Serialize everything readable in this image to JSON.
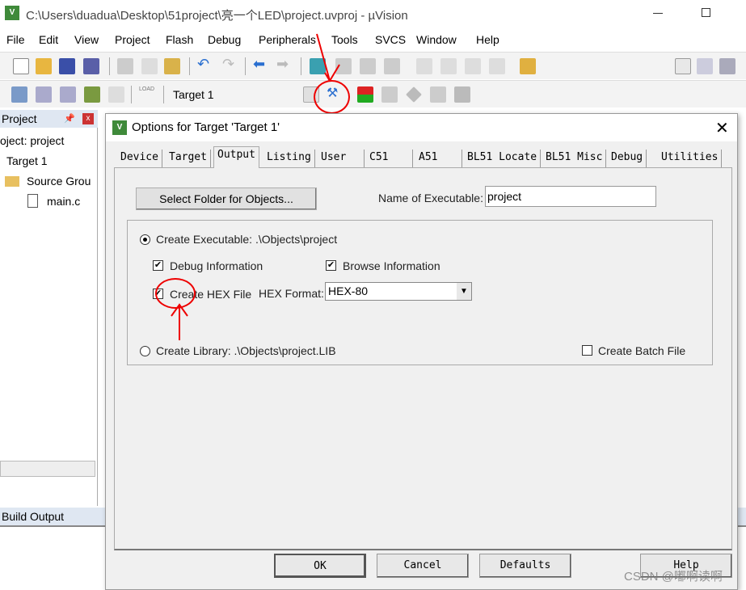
{
  "window": {
    "title": "C:\\Users\\duadua\\Desktop\\51project\\亮一个LED\\project.uvproj - µVision",
    "logo": "Vs"
  },
  "menu": [
    "File",
    "Edit",
    "View",
    "Project",
    "Flash",
    "Debug",
    "Peripherals",
    "Tools",
    "SVCS",
    "Window",
    "Help"
  ],
  "toolbar2": {
    "target": "Target 1",
    "load": "LOAD"
  },
  "sidebar": {
    "title": "Project",
    "tree": [
      "oject: project",
      "Target 1",
      "Source Grou",
      "main.c"
    ]
  },
  "build_output": "Build Output",
  "dialog": {
    "title": "Options for Target 'Target 1'",
    "tabs": [
      "Device",
      "Target",
      "Output",
      "Listing",
      "User",
      "C51",
      "A51",
      "BL51 Locate",
      "BL51 Misc",
      "Debug",
      "Utilities"
    ],
    "active_tab": "Output",
    "select_folder": "Select Folder for Objects...",
    "name_exec_label": "Name of Executable:",
    "name_exec_value": "project",
    "create_exec": "Create Executable:  .\\Objects\\project",
    "debug_info": "Debug Information",
    "browse_info": "Browse Information",
    "create_hex": "Create HEX File",
    "hex_format_label": "HEX Format:",
    "hex_format_value": "HEX-80",
    "create_lib": "Create Library:  .\\Objects\\project.LIB",
    "batch": "Create Batch File",
    "buttons": {
      "ok": "OK",
      "cancel": "Cancel",
      "defaults": "Defaults",
      "help": "Help"
    }
  },
  "watermark": "CSDN @嘟啊读啊"
}
